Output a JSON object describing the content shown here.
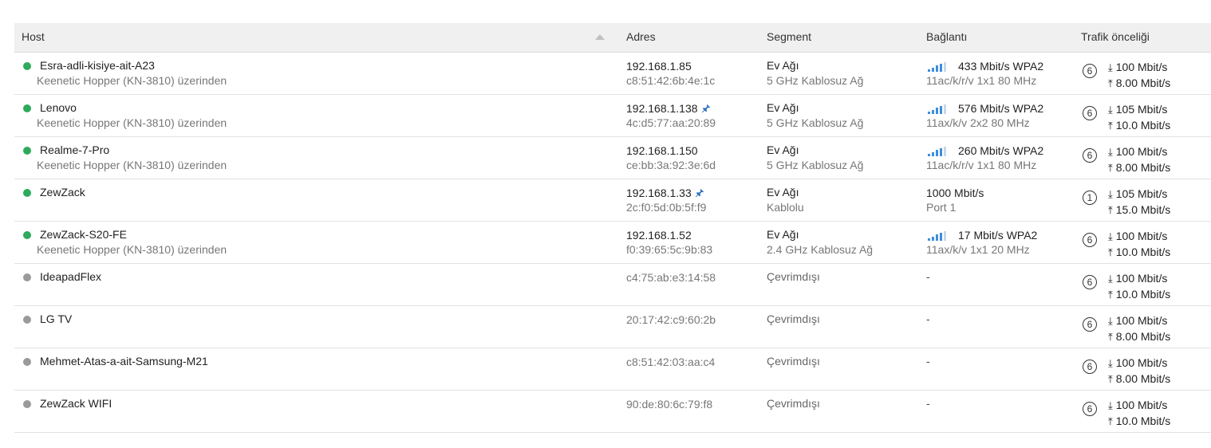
{
  "table": {
    "headers": {
      "host": "Host",
      "address": "Adres",
      "segment": "Segment",
      "connection": "Bağlantı",
      "priority": "Trafik önceliği"
    },
    "colors": {
      "online": "#2eaa5c",
      "offline": "#9a9a9a",
      "signal": "#3b8dde"
    },
    "rows": [
      {
        "name": "Esra-adli-kisiye-ait-A23",
        "status": "online",
        "via": "Keenetic Hopper (KN-3810) üzerinden",
        "ip": "192.168.1.85",
        "pinned": false,
        "mac": "c8:51:42:6b:4e:1c",
        "segment": "Ev Ağı",
        "segment_sub": "5 GHz Kablosuz Ağ",
        "conn_type": "wifi",
        "speed": "433 Mbit/s WPA2",
        "conn_sub": "11ac/k/r/v 1x1 80 MHz",
        "priority": "6",
        "down": "100 Mbit/s",
        "up": "8.00 Mbit/s"
      },
      {
        "name": "Lenovo",
        "status": "online",
        "via": "Keenetic Hopper (KN-3810) üzerinden",
        "ip": "192.168.1.138",
        "pinned": true,
        "mac": "4c:d5:77:aa:20:89",
        "segment": "Ev Ağı",
        "segment_sub": "5 GHz Kablosuz Ağ",
        "conn_type": "wifi",
        "speed": "576 Mbit/s WPA2",
        "conn_sub": "11ax/k/v 2x2 80 MHz",
        "priority": "6",
        "down": "105 Mbit/s",
        "up": "10.0 Mbit/s"
      },
      {
        "name": "Realme-7-Pro",
        "status": "online",
        "via": "Keenetic Hopper (KN-3810) üzerinden",
        "ip": "192.168.1.150",
        "pinned": false,
        "mac": "ce:bb:3a:92:3e:6d",
        "segment": "Ev Ağı",
        "segment_sub": "5 GHz Kablosuz Ağ",
        "conn_type": "wifi",
        "speed": "260 Mbit/s WPA2",
        "conn_sub": "11ac/k/r/v 1x1 80 MHz",
        "priority": "6",
        "down": "100 Mbit/s",
        "up": "8.00 Mbit/s"
      },
      {
        "name": "ZewZack",
        "status": "online",
        "via": "",
        "ip": "192.168.1.33",
        "pinned": true,
        "mac": "2c:f0:5d:0b:5f:f9",
        "segment": "Ev Ağı",
        "segment_sub": "Kablolu",
        "conn_type": "wired",
        "speed": "1000 Mbit/s",
        "conn_sub": "Port 1",
        "priority": "1",
        "down": "105 Mbit/s",
        "up": "15.0 Mbit/s"
      },
      {
        "name": "ZewZack-S20-FE",
        "status": "online",
        "via": "Keenetic Hopper (KN-3810) üzerinden",
        "ip": "192.168.1.52",
        "pinned": false,
        "mac": "f0:39:65:5c:9b:83",
        "segment": "Ev Ağı",
        "segment_sub": "2.4 GHz Kablosuz Ağ",
        "conn_type": "wifi",
        "speed": "17 Mbit/s WPA2",
        "conn_sub": "11ax/k/v 1x1 20 MHz",
        "priority": "6",
        "down": "100 Mbit/s",
        "up": "10.0 Mbit/s"
      },
      {
        "name": "IdeapadFlex",
        "status": "offline",
        "via": "",
        "ip": "",
        "pinned": false,
        "mac": "c4:75:ab:e3:14:58",
        "segment": "Çevrimdışı",
        "segment_sub": "",
        "conn_type": "none",
        "speed": "-",
        "conn_sub": "",
        "priority": "6",
        "down": "100 Mbit/s",
        "up": "10.0 Mbit/s"
      },
      {
        "name": "LG TV",
        "status": "offline",
        "via": "",
        "ip": "",
        "pinned": false,
        "mac": "20:17:42:c9:60:2b",
        "segment": "Çevrimdışı",
        "segment_sub": "",
        "conn_type": "none",
        "speed": "-",
        "conn_sub": "",
        "priority": "6",
        "down": "100 Mbit/s",
        "up": "8.00 Mbit/s"
      },
      {
        "name": "Mehmet-Atas-a-ait-Samsung-M21",
        "status": "offline",
        "via": "",
        "ip": "",
        "pinned": false,
        "mac": "c8:51:42:03:aa:c4",
        "segment": "Çevrimdışı",
        "segment_sub": "",
        "conn_type": "none",
        "speed": "-",
        "conn_sub": "",
        "priority": "6",
        "down": "100 Mbit/s",
        "up": "8.00 Mbit/s"
      },
      {
        "name": "ZewZack WIFI",
        "status": "offline",
        "via": "",
        "ip": "",
        "pinned": false,
        "mac": "90:de:80:6c:79:f8",
        "segment": "Çevrimdışı",
        "segment_sub": "",
        "conn_type": "none",
        "speed": "-",
        "conn_sub": "",
        "priority": "6",
        "down": "100 Mbit/s",
        "up": "10.0 Mbit/s"
      }
    ]
  }
}
